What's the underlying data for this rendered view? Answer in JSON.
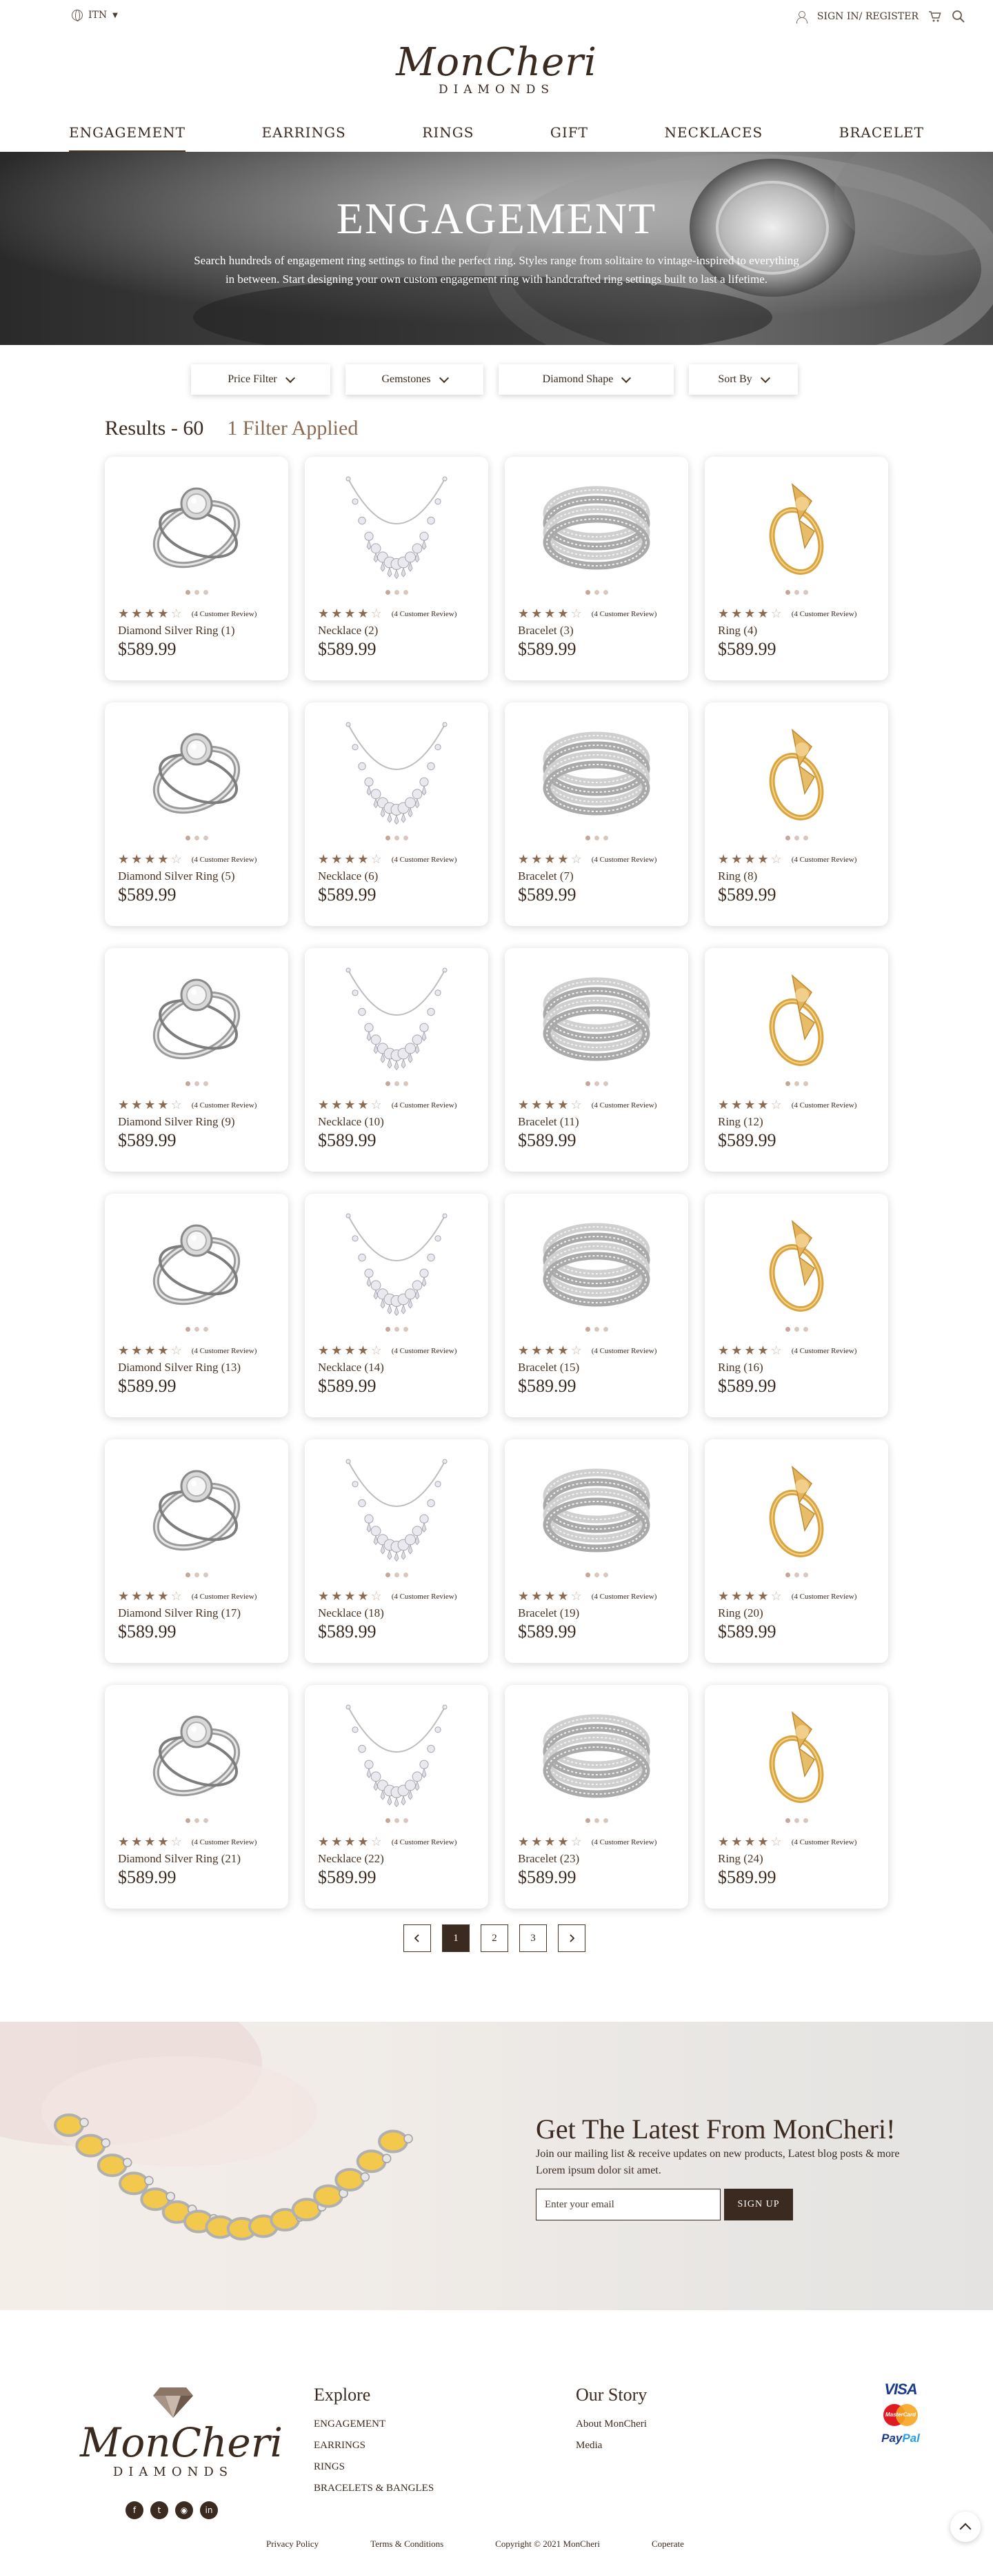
{
  "topbar": {
    "language": "ITN",
    "signin_label": "SIGN IN/ REGISTER"
  },
  "logo": {
    "script": "MonCheri",
    "sub": "DIAMONDS"
  },
  "nav": {
    "items": [
      "ENGAGEMENT",
      "EARRINGS",
      "RINGS",
      "GIFT",
      "NECKLACES",
      "BRACELET"
    ],
    "active": "ENGAGEMENT"
  },
  "hero": {
    "title": "ENGAGEMENT",
    "description": "Search hundreds of engagement ring settings to find the perfect ring. Styles range from solitaire to vintage-inspired to everything in between. Start designing your own custom engagement ring with handcrafted ring settings built to last a lifetime."
  },
  "filters": {
    "price": "Price Filter",
    "gemstones": "Gemstones",
    "shape": "Diamond Shape",
    "sort": "Sort By"
  },
  "results": {
    "count_label": "Results - 60",
    "applied_label": "1 Filter Applied"
  },
  "products": [
    {
      "name": "Diamond Silver Ring (1)",
      "price": "$589.99",
      "review": "(4 Customer Review)",
      "rating": 4,
      "kind": "ring"
    },
    {
      "name": "Necklace (2)",
      "price": "$589.99",
      "review": "(4 Customer Review)",
      "rating": 4,
      "kind": "necklace"
    },
    {
      "name": "Bracelet (3)",
      "price": "$589.99",
      "review": "(4 Customer Review)",
      "rating": 4,
      "kind": "bracelet"
    },
    {
      "name": "Ring (4)",
      "price": "$589.99",
      "review": "(4 Customer Review)",
      "rating": 4,
      "kind": "gold"
    },
    {
      "name": "Diamond Silver Ring (5)",
      "price": "$589.99",
      "review": "(4 Customer Review)",
      "rating": 4,
      "kind": "ring"
    },
    {
      "name": "Necklace (6)",
      "price": "$589.99",
      "review": "(4 Customer Review)",
      "rating": 4,
      "kind": "necklace"
    },
    {
      "name": "Bracelet (7)",
      "price": "$589.99",
      "review": "(4 Customer Review)",
      "rating": 4,
      "kind": "bracelet"
    },
    {
      "name": "Ring (8)",
      "price": "$589.99",
      "review": "(4 Customer Review)",
      "rating": 4,
      "kind": "gold"
    },
    {
      "name": "Diamond Silver Ring (9)",
      "price": "$589.99",
      "review": "(4 Customer Review)",
      "rating": 4,
      "kind": "ring"
    },
    {
      "name": "Necklace (10)",
      "price": "$589.99",
      "review": "(4 Customer Review)",
      "rating": 4,
      "kind": "necklace"
    },
    {
      "name": "Bracelet (11)",
      "price": "$589.99",
      "review": "(4 Customer Review)",
      "rating": 4,
      "kind": "bracelet"
    },
    {
      "name": "Ring (12)",
      "price": "$589.99",
      "review": "(4 Customer Review)",
      "rating": 4,
      "kind": "gold"
    },
    {
      "name": "Diamond Silver Ring (13)",
      "price": "$589.99",
      "review": "(4 Customer Review)",
      "rating": 4,
      "kind": "ring"
    },
    {
      "name": "Necklace (14)",
      "price": "$589.99",
      "review": "(4 Customer Review)",
      "rating": 4,
      "kind": "necklace"
    },
    {
      "name": "Bracelet (15)",
      "price": "$589.99",
      "review": "(4 Customer Review)",
      "rating": 4,
      "kind": "bracelet"
    },
    {
      "name": "Ring (16)",
      "price": "$589.99",
      "review": "(4 Customer Review)",
      "rating": 4,
      "kind": "gold"
    },
    {
      "name": "Diamond Silver Ring (17)",
      "price": "$589.99",
      "review": "(4 Customer Review)",
      "rating": 4,
      "kind": "ring"
    },
    {
      "name": "Necklace (18)",
      "price": "$589.99",
      "review": "(4 Customer Review)",
      "rating": 4,
      "kind": "necklace"
    },
    {
      "name": "Bracelet (19)",
      "price": "$589.99",
      "review": "(4 Customer Review)",
      "rating": 4,
      "kind": "bracelet"
    },
    {
      "name": "Ring (20)",
      "price": "$589.99",
      "review": "(4 Customer Review)",
      "rating": 4,
      "kind": "gold"
    },
    {
      "name": "Diamond Silver Ring (21)",
      "price": "$589.99",
      "review": "(4 Customer Review)",
      "rating": 4,
      "kind": "ring"
    },
    {
      "name": "Necklace (22)",
      "price": "$589.99",
      "review": "(4 Customer Review)",
      "rating": 4,
      "kind": "necklace"
    },
    {
      "name": "Bracelet (23)",
      "price": "$589.99",
      "review": "(4 Customer Review)",
      "rating": 4,
      "kind": "bracelet"
    },
    {
      "name": "Ring (24)",
      "price": "$589.99",
      "review": "(4 Customer Review)",
      "rating": 4,
      "kind": "gold"
    }
  ],
  "pagination": {
    "pages": [
      "1",
      "2",
      "3"
    ],
    "current": "1"
  },
  "newsletter": {
    "title": "Get The Latest From MonCheri!",
    "text": "Join our mailing list & receive updates on new products, Latest blog posts & more Lorem ipsum dolor sit amet.",
    "placeholder": "Enter your email",
    "button": "SIGN UP"
  },
  "footer": {
    "explore_title": "Explore",
    "explore_links": [
      "ENGAGEMENT",
      "EARRINGS",
      "RINGS",
      "BRACELETS & BANGLES"
    ],
    "story_title": "Our Story",
    "story_links": [
      "About MonCheri",
      "Media"
    ],
    "payments": {
      "visa": "VISA",
      "mastercard": "MasterCard",
      "paypal_a": "Pay",
      "paypal_b": "Pal"
    },
    "bottom_links": [
      "Privacy Policy",
      "Terms & Conditions",
      "Copyright © 2021 MonCheri",
      "Coperate"
    ]
  },
  "colors": {
    "brand": "#3b2a20",
    "accent": "#8c6a50",
    "star_off": "#c9b7a9"
  }
}
